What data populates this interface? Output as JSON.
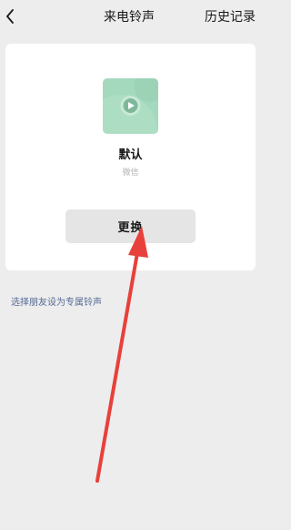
{
  "header": {
    "back_icon": "chevron-left-icon",
    "title": "来电铃声",
    "history_label": "历史记录"
  },
  "current_ringtone": {
    "cover_icon": "play-icon",
    "cover_color": "#a4d9be",
    "name": "默认",
    "source": "微信"
  },
  "change_button": {
    "label": "更换"
  },
  "friend_link": {
    "label": "选择朋友设为专属铃声",
    "color": "#576b95"
  },
  "annotation": {
    "arrow_icon": "red-arrow-icon",
    "color": "#e8403a"
  }
}
